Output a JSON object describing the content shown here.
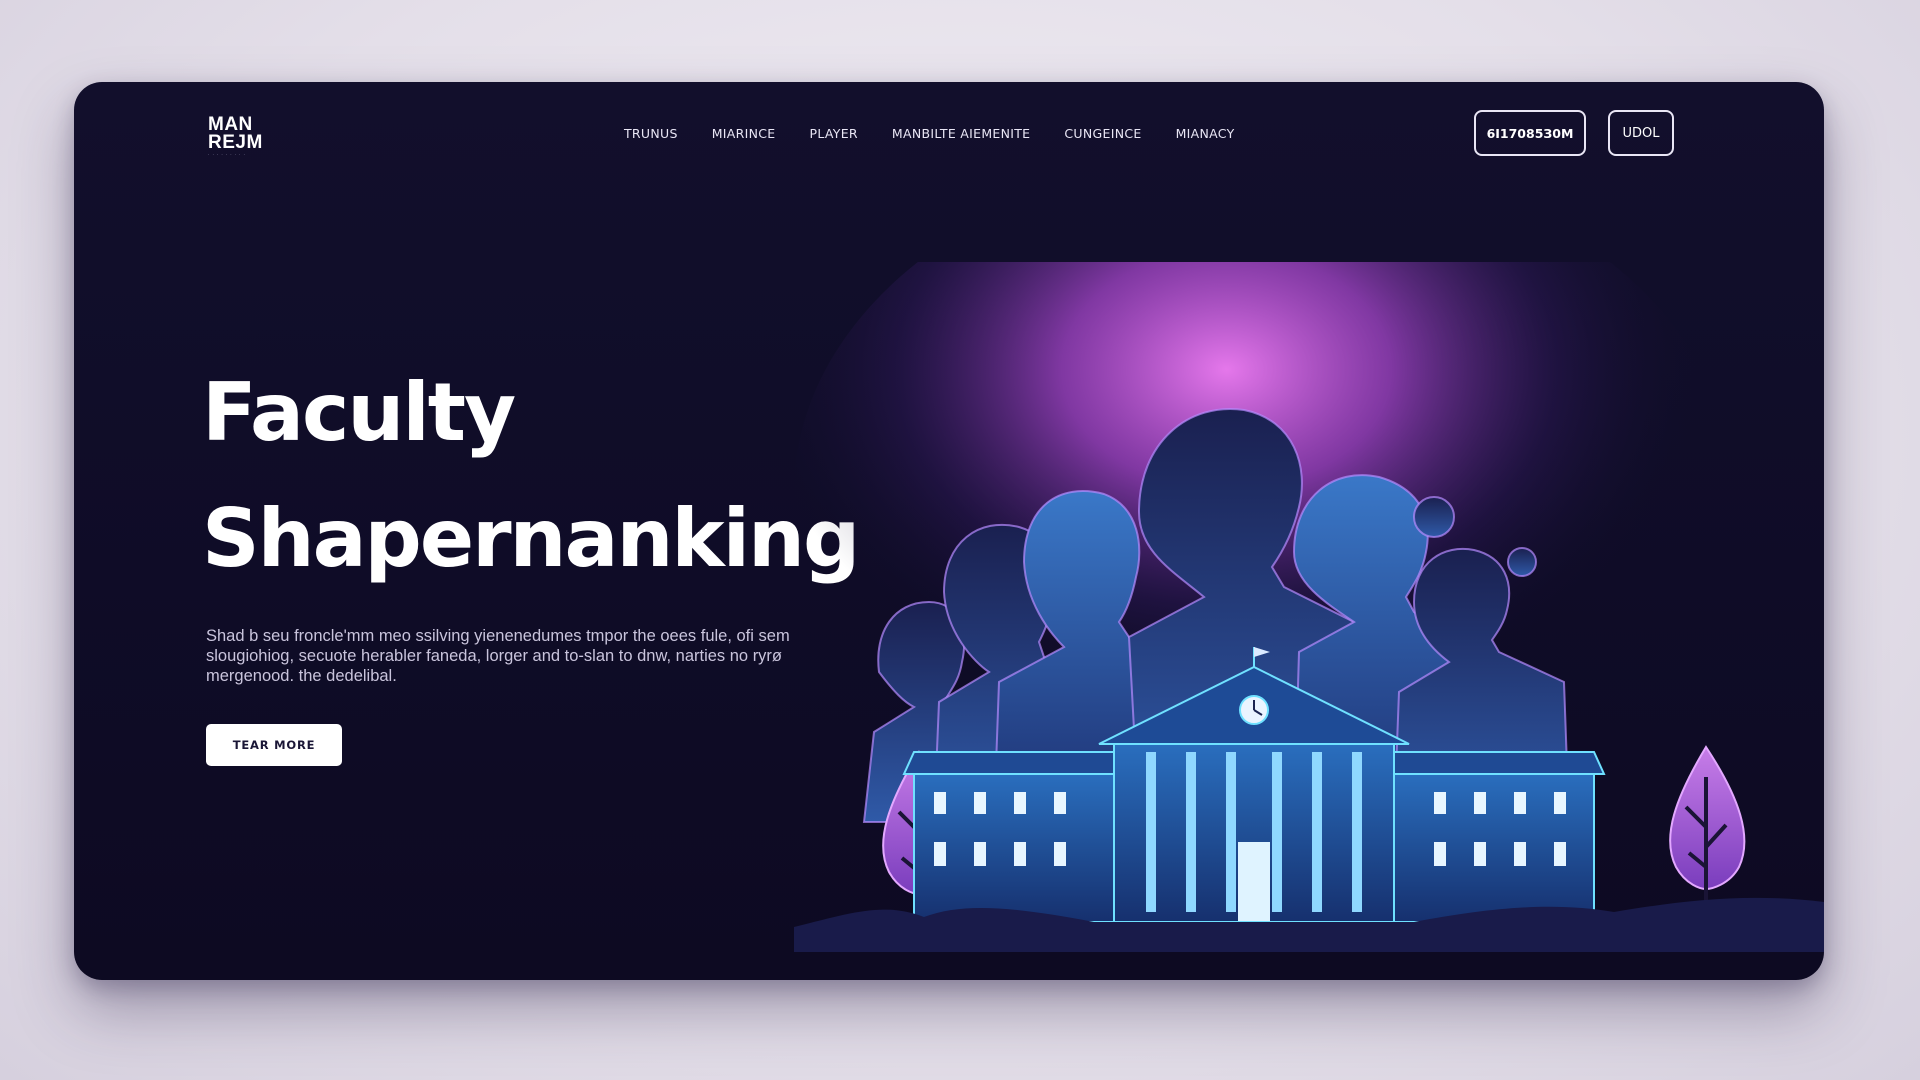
{
  "header": {
    "logo_line1": "MAN",
    "logo_line2": "REJM",
    "menu": [
      {
        "label": "TRUNUS"
      },
      {
        "label": "MIARINCE"
      },
      {
        "label": "PLAYER"
      },
      {
        "label": "MANBILTE AIEMENITE"
      },
      {
        "label": "CUNGEINCE"
      },
      {
        "label": "MIANACY"
      }
    ],
    "button_primary": "6I17085З0M",
    "button_secondary": "UDOL"
  },
  "hero": {
    "title_line1": "Faculty",
    "title_line2": "Shapernanking",
    "description": "Shad b seu froncle'mm meo ssilving yienenedumes tmpor the oees fule, ofi sem slougiohiog, secuote herabler faneda, lorger and to-slan to dnw, narties no ryrø mergenood. the dedelibal.",
    "cta_label": "TEAR MORE"
  },
  "colors": {
    "card_bg": "#120f2c",
    "accent_glow": "#e26bf0",
    "accent_blue": "#3aa8f0",
    "text": "#ffffff"
  }
}
